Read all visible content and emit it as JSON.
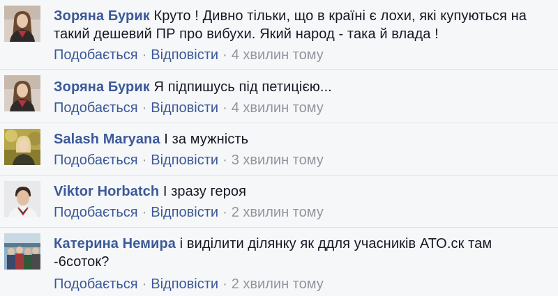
{
  "comments": [
    {
      "author": "Зоряна Бурик",
      "text": "Круто ! Дивно тільки, що в країні є лохи, які купуються на такий дешевий ПР про вибухи. Який народ - така й влада !",
      "like_label": "Подобається",
      "reply_label": "Відповісти",
      "time": "4 хвилин тому"
    },
    {
      "author": "Зоряна Бурик",
      "text": "Я підпишусь під петицією...",
      "like_label": "Подобається",
      "reply_label": "Відповісти",
      "time": "4 хвилин тому"
    },
    {
      "author": "Salash Maryana",
      "text": "І за мужність",
      "like_label": "Подобається",
      "reply_label": "Відповісти",
      "time": "3 хвилин тому"
    },
    {
      "author": "Viktor Horbatch",
      "text": "І зразу героя",
      "like_label": "Подобається",
      "reply_label": "Відповісти",
      "time": "2 хвилин тому"
    },
    {
      "author": "Катерина Немира",
      "text": "і виділити ділянку як ддля учасників АТО.ск там -6соток?",
      "like_label": "Подобається",
      "reply_label": "Відповісти",
      "time": "2 хвилин тому"
    }
  ],
  "separator": "·",
  "colors": {
    "author_link": "#3b5998",
    "text": "#141823",
    "meta": "#90949c",
    "row_background": "#f6f7f9",
    "divider": "#dfe1e5"
  }
}
